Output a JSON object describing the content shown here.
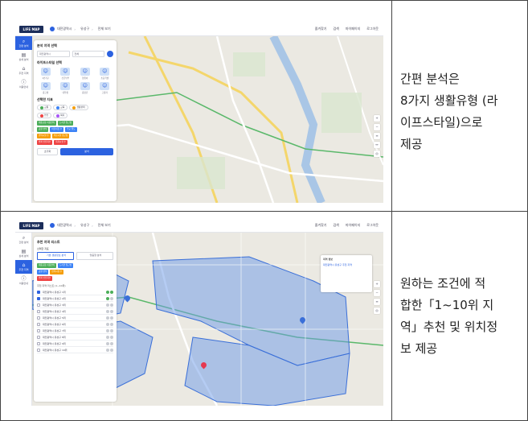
{
  "captions": {
    "row1": [
      "간편 분석은",
      "8가지 생활유형 (라",
      "이프스타일)으로",
      "제공"
    ],
    "row2": [
      "원하는 조건에 적",
      "합한「1~10위 지",
      "역」추천 및 위치정",
      "보 제공"
    ]
  },
  "app": {
    "logo": "LIFE MAP",
    "breadcrumb": [
      "대전광역시",
      "유성구",
      "전체 보기"
    ],
    "util": [
      "즐겨찾기",
      "검색",
      "마이페이지",
      "로그아웃"
    ],
    "rail": [
      {
        "label": "간편 분석",
        "icon": "search-icon"
      },
      {
        "label": "상세 분석",
        "icon": "document-icon"
      },
      {
        "label": "추천 지역",
        "icon": "home-icon"
      },
      {
        "label": "이용안내",
        "icon": "info-icon"
      }
    ]
  },
  "screen1": {
    "section_area": "분석 지역 선택",
    "select_city": "대전광역시",
    "select_district": "전체",
    "section_life": "라이프스타일 선택",
    "life_types": [
      "1인가구",
      "신혼부부",
      "영유아",
      "초등학생",
      "중고생",
      "대학생",
      "중장년",
      "고령자"
    ],
    "section_cond": "선택한 지표",
    "chips": [
      "교통",
      "교육",
      "생활편의",
      "안전",
      "복지"
    ],
    "tags": [
      {
        "text": "대중교통 이용편의",
        "color": "#4cae5a"
      },
      {
        "text": "도서관 접근성",
        "color": "#4cae5a"
      },
      {
        "text": "공원 면적",
        "color": "#4cae5a"
      },
      {
        "text": "어린이집 수",
        "color": "#3b82f6"
      },
      {
        "text": "학교 밀도",
        "color": "#3b82f6"
      },
      {
        "text": "편의시설 수",
        "color": "#f59e0b"
      },
      {
        "text": "의료시설 접근성",
        "color": "#f59e0b"
      },
      {
        "text": "범죄 안전지수",
        "color": "#ef4444"
      },
      {
        "text": "복지시설 수",
        "color": "#ef4444"
      }
    ],
    "reset": "초기화",
    "analyze": "분석"
  },
  "screen2": {
    "title": "추천 지역 리스트",
    "section_tabs": "선택한 지표",
    "tab_basic": "기본 생활정보 분석",
    "tab_custom": "맞춤형 분석",
    "tags": [
      {
        "text": "대중교통 이용편의",
        "color": "#4cae5a"
      },
      {
        "text": "도서관 접근성",
        "color": "#3b82f6"
      },
      {
        "text": "공원 면적",
        "color": "#3b82f6"
      },
      {
        "text": "편의시설 수",
        "color": "#f59e0b"
      },
      {
        "text": "범죄 안전지수",
        "color": "#ef4444"
      }
    ],
    "list_head": "추천 지역 리스트 (1~10위)",
    "rows": [
      "대전광역시 유성구 1위",
      "대전광역시 유성구 2위",
      "대전광역시 유성구 3위",
      "대전광역시 유성구 4위",
      "대전광역시 유성구 5위",
      "대전광역시 유성구 6위",
      "대전광역시 유성구 7위",
      "대전광역시 유성구 8위",
      "대전광역시 유성구 9위",
      "대전광역시 유성구 10위"
    ],
    "popup_title": "지역 정보",
    "popup_text": "대전광역시 유성구 추천 지역"
  }
}
